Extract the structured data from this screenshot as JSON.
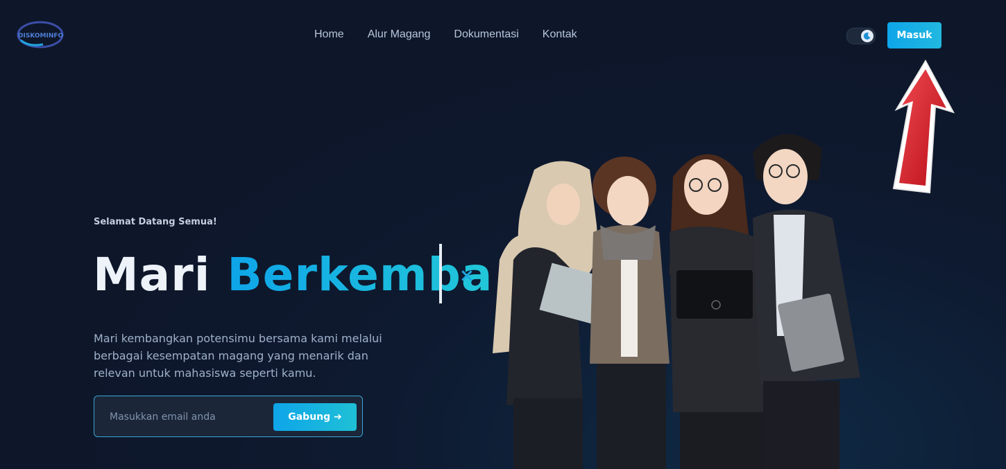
{
  "header": {
    "logo_text": "DISKOMINFO",
    "nav": [
      {
        "label": "Home"
      },
      {
        "label": "Alur Magang"
      },
      {
        "label": "Dokumentasi"
      },
      {
        "label": "Kontak"
      }
    ],
    "theme_toggle": {
      "icon": "moon-icon",
      "state": "dark"
    },
    "login_label": "Masuk"
  },
  "hero": {
    "greeting": "Selamat Datang Semua!",
    "headline_word1": "Mari",
    "headline_word2": "Berkemba",
    "close_symbol": "×",
    "description": "Mari kembangkan potensimu bersama kami melalui berbagai kesempatan magang yang menarik dan relevan untuk mahasiswa seperti kamu.",
    "email_placeholder": "Masukkan email anda",
    "join_label": "Gabung ➔"
  },
  "annotation": {
    "arrow_color": "#d9141e",
    "arrow_target": "login-button"
  },
  "colors": {
    "background": "#0e1629",
    "accent": "#0ea5e9",
    "nav_text": "#b7c6dc"
  }
}
